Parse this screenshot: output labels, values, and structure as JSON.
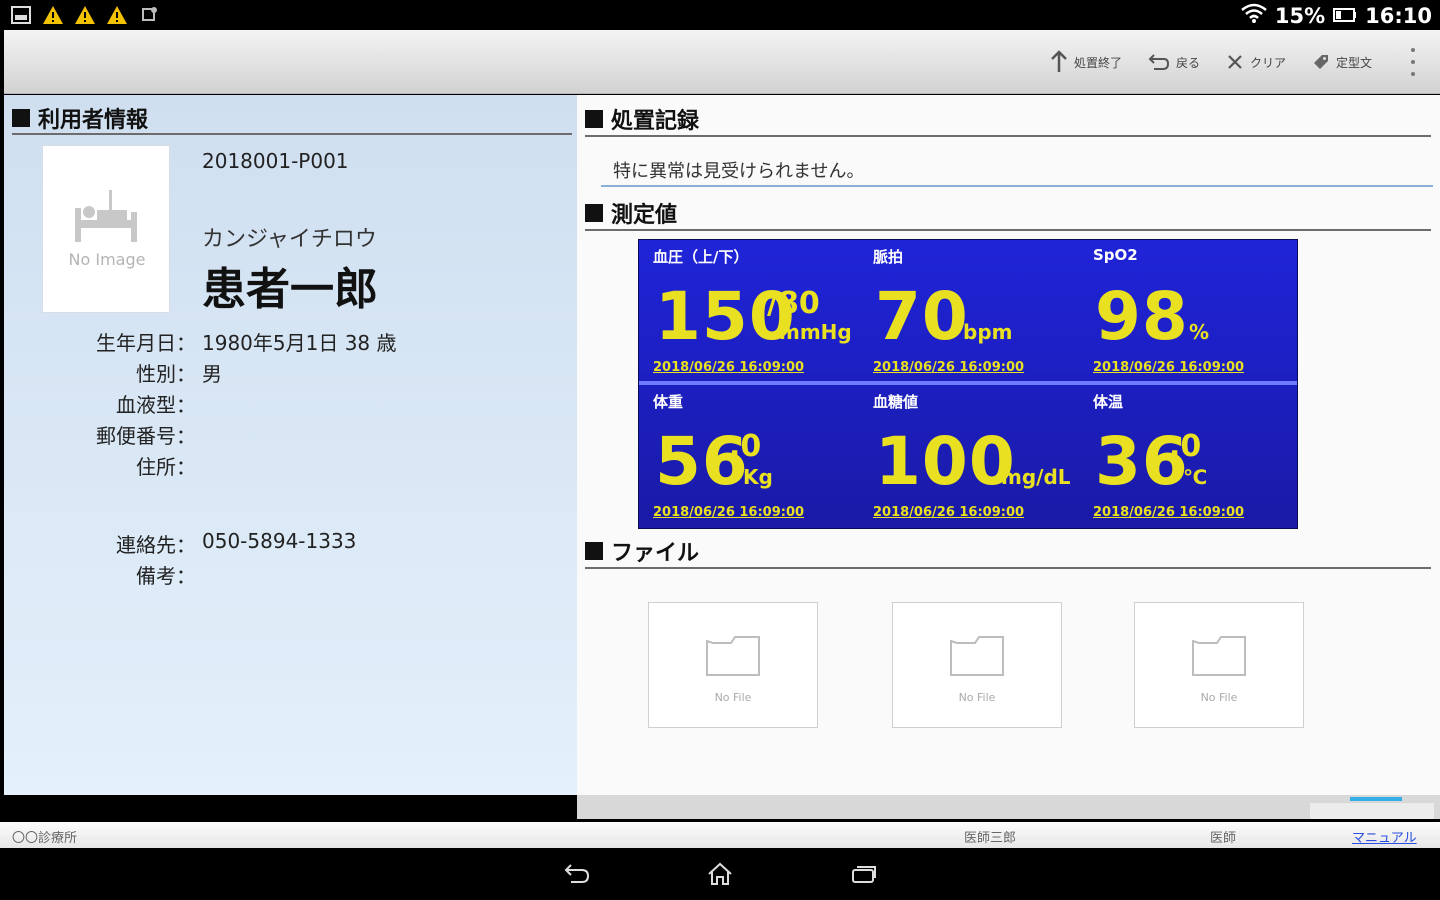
{
  "status_bar": {
    "battery_percent": "15%",
    "time": "16:10",
    "left_icons": [
      "screenshot-icon",
      "warning-icon",
      "warning-icon",
      "warning-icon",
      "sync-icon"
    ]
  },
  "toolbar": {
    "finish_label": "処置終了",
    "back_label": "戻る",
    "clear_label": "クリア",
    "template_label": "定型文"
  },
  "user_info": {
    "section_title": "利用者情報",
    "no_image": "No Image",
    "id": "2018001-P001",
    "kana": "カンジャイチロウ",
    "name": "患者一郎",
    "fields": [
      {
        "label": "生年月日：",
        "value": "1980年5月1日 38 歳"
      },
      {
        "label": "性別：",
        "value": "男"
      },
      {
        "label": "血液型：",
        "value": ""
      },
      {
        "label": "郵便番号：",
        "value": ""
      },
      {
        "label": "住所：",
        "value": ""
      },
      {
        "label": "連絡先：",
        "value": "050-5894-1333"
      },
      {
        "label": "備考：",
        "value": ""
      }
    ]
  },
  "treatment": {
    "section_title": "処置記録",
    "note": "特に異常は見受けられません。"
  },
  "measurements": {
    "section_title": "測定値",
    "colors": {
      "panel": "#1f24d8",
      "value": "#e8e020"
    },
    "items": [
      {
        "label": "血圧（上/下）",
        "value": "150",
        "sub": "/80",
        "unit": "mmHg",
        "date": "2018/06/26 16:09:00"
      },
      {
        "label": "脈拍",
        "value": "70",
        "unit": "bpm",
        "date": "2018/06/26 16:09:00"
      },
      {
        "label": "SpO2",
        "value": "98",
        "unit": "%",
        "date": "2018/06/26 16:09:00"
      },
      {
        "label": "体重",
        "value": "56",
        "decimal": ".0",
        "unit": "Kg",
        "date": "2018/06/26 16:09:00"
      },
      {
        "label": "血糖値",
        "value": "100",
        "unit": "mg/dL",
        "date": "2018/06/26 16:09:00"
      },
      {
        "label": "体温",
        "value": "36",
        "decimal": ".0",
        "unit": "℃",
        "date": "2018/06/26 16:09:00"
      }
    ]
  },
  "files": {
    "section_title": "ファイル",
    "items": [
      "No File",
      "No File",
      "No File"
    ]
  },
  "footer": {
    "clinic": "〇〇診療所",
    "doctor": "医師三郎",
    "role": "医師",
    "manual_link": "マニュアル"
  }
}
